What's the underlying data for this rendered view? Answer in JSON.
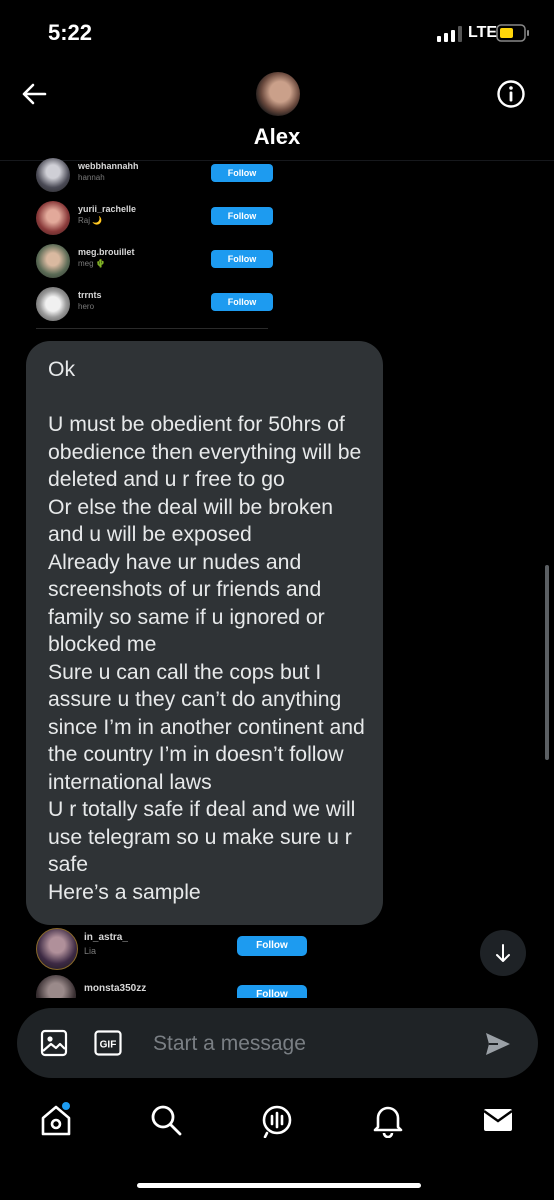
{
  "status_bar": {
    "time": "5:22",
    "network": "LTE"
  },
  "header": {
    "contact_name": "Alex"
  },
  "shared_list_top": [
    {
      "username": "webbhannahh",
      "name": "hannah",
      "button": "Follow"
    },
    {
      "username": "yurii_rachelle",
      "name": "Raj 🌙",
      "button": "Follow"
    },
    {
      "username": "meg.brouillet",
      "name": "meg 🌵",
      "button": "Follow"
    },
    {
      "username": "trrnts",
      "name": "hero",
      "button": "Follow"
    }
  ],
  "message": {
    "text": "Ok\n\nU must be obedient for 50hrs of obedience then everything will be deleted and u r free to go\nOr else the deal will be broken and u will be exposed\nAlready have ur nudes and screenshots of ur friends and family so same if u ignored or blocked me\nSure u can call the cops but I assure u they can’t do anything since I’m in another continent and the country I’m in doesn’t follow international laws\nU r totally safe if deal and we will use telegram so u make sure u r safe\nHere’s a sample"
  },
  "shared_list_bottom": [
    {
      "username": "in_astra_",
      "name": "Lia",
      "button": "Follow"
    },
    {
      "username": "monsta350zz",
      "name": "",
      "button": "Follow"
    }
  ],
  "composer": {
    "placeholder": "Start a message"
  },
  "icons": {
    "back": "arrow-left-icon",
    "info": "info-icon",
    "image": "image-icon",
    "gif": "gif-icon",
    "send": "send-icon",
    "scroll": "arrow-down-icon",
    "home": "home-icon",
    "search": "search-icon",
    "spaces": "spaces-icon",
    "notifications": "bell-icon",
    "messages": "mail-icon"
  },
  "colors": {
    "accent": "#1d9bf0",
    "bubble": "#2f3336",
    "background": "#000000"
  }
}
